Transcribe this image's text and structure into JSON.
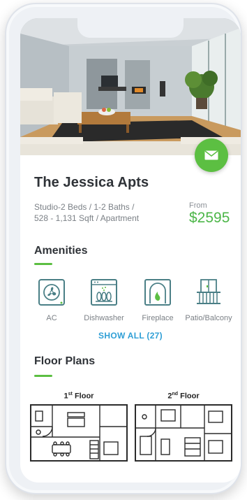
{
  "listing": {
    "name": "The Jessica Apts",
    "beds_baths": "Studio-2 Beds / 1-2 Baths /",
    "size": "528 - 1,131 Sqft / Apartment",
    "price_prefix": "From",
    "price": "$2595"
  },
  "amenities": {
    "heading": "Amenities",
    "items": [
      {
        "label": "AC",
        "icon": "ac-fan-icon"
      },
      {
        "label": "Dishwasher",
        "icon": "dishwasher-icon"
      },
      {
        "label": "Fireplace",
        "icon": "fireplace-icon"
      },
      {
        "label": "Patio/Balcony",
        "icon": "balcony-icon"
      }
    ],
    "show_all": "SHOW ALL (27)"
  },
  "floor_plans": {
    "heading": "Floor Plans",
    "items": [
      {
        "ordinal": "1",
        "suffix": "st",
        "name": "Floor"
      },
      {
        "ordinal": "2",
        "suffix": "nd",
        "name": "Floor"
      }
    ]
  },
  "colors": {
    "accent": "#5cbf42",
    "price": "#4cb648",
    "link": "#2f9fd6",
    "icon": "#4a7f86"
  }
}
